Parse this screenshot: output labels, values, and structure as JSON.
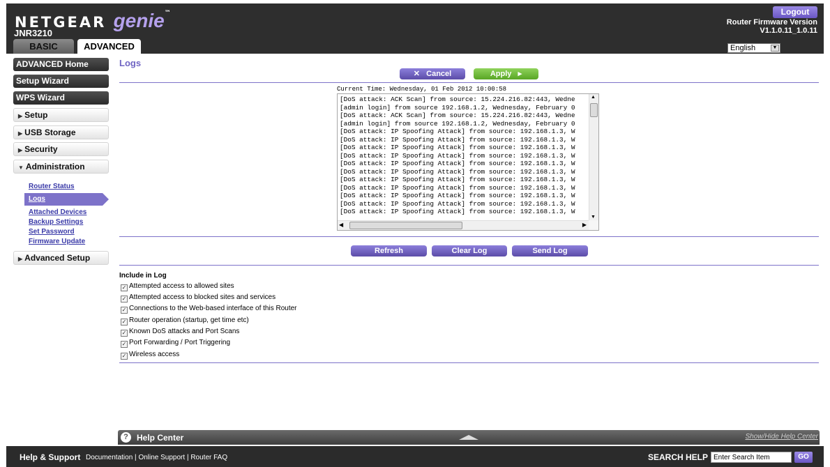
{
  "header": {
    "brand": "NETGEAR",
    "product": "genie",
    "trademark": "™",
    "model": "JNR3210",
    "logout_label": "Logout",
    "firmware_label": "Router Firmware Version",
    "firmware_version": "V1.1.0.11_1.0.11"
  },
  "tabs": [
    {
      "label": "BASIC",
      "active": false
    },
    {
      "label": "ADVANCED",
      "active": true
    }
  ],
  "language": {
    "selected": "English"
  },
  "sidebar": {
    "main_items": [
      "ADVANCED Home",
      "Setup Wizard",
      "WPS Wizard"
    ],
    "sections": [
      "Setup",
      "USB Storage",
      "Security",
      "Administration"
    ],
    "admin_subitems": [
      "Router Status",
      "Logs",
      "Attached Devices",
      "Backup Settings",
      "Set Password",
      "Firmware Update"
    ],
    "active_subitem": "Logs",
    "advanced_setup": "Advanced Setup"
  },
  "main": {
    "title": "Logs",
    "cancel_label": "Cancel",
    "apply_label": "Apply",
    "current_time": "Current Time: Wednesday, 01 Feb 2012 10:00:58",
    "log_lines": [
      "[DoS attack: ACK Scan] from source: 15.224.216.82:443, Wedne",
      "[admin login] from source 192.168.1.2, Wednesday, February 0",
      "[DoS attack: ACK Scan] from source: 15.224.216.82:443, Wedne",
      "[admin login] from source 192.168.1.2, Wednesday, February 0",
      "[DoS attack: IP Spoofing Attack] from source: 192.168.1.3, W",
      "[DoS attack: IP Spoofing Attack] from source: 192.168.1.3, W",
      "[DoS attack: IP Spoofing Attack] from source: 192.168.1.3, W",
      "[DoS attack: IP Spoofing Attack] from source: 192.168.1.3, W",
      "[DoS attack: IP Spoofing Attack] from source: 192.168.1.3, W",
      "[DoS attack: IP Spoofing Attack] from source: 192.168.1.3, W",
      "[DoS attack: IP Spoofing Attack] from source: 192.168.1.3, W",
      "[DoS attack: IP Spoofing Attack] from source: 192.168.1.3, W",
      "[DoS attack: IP Spoofing Attack] from source: 192.168.1.3, W",
      "[DoS attack: IP Spoofing Attack] from source: 192.168.1.3, W",
      "[DoS attack: IP Spoofing Attack] from source: 192.168.1.3, W"
    ],
    "refresh_label": "Refresh",
    "clear_label": "Clear Log",
    "send_label": "Send Log",
    "include_title": "Include in Log",
    "include_options": [
      {
        "label": "Attempted access to allowed sites",
        "checked": true
      },
      {
        "label": "Attempted access to blocked sites and services",
        "checked": true
      },
      {
        "label": "Connections to the Web-based interface of this Router",
        "checked": true
      },
      {
        "label": "Router operation (startup, get time etc)",
        "checked": true
      },
      {
        "label": "Known DoS attacks and Port Scans",
        "checked": true
      },
      {
        "label": "Port Forwarding / Port Triggering",
        "checked": true
      },
      {
        "label": "Wireless access",
        "checked": true
      }
    ]
  },
  "help_center": {
    "title": "Help Center",
    "toggle_label": "Show/Hide Help Center"
  },
  "footer": {
    "support_title": "Help & Support",
    "links": [
      "Documentation",
      "Online Support",
      "Router FAQ"
    ],
    "search_label": "SEARCH HELP",
    "search_value": "Enter Search Item",
    "go_label": "GO"
  },
  "colors": {
    "accent_purple": "#7d72c9",
    "apply_green": "#6dbb35",
    "header_dark": "#2e2e2e"
  }
}
